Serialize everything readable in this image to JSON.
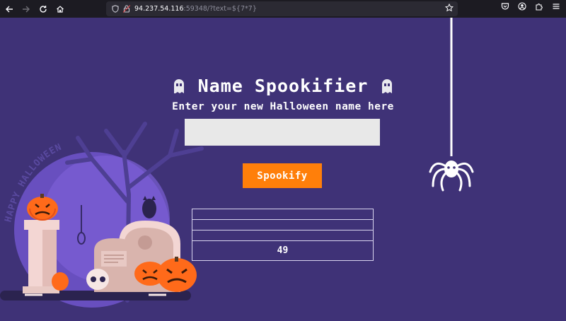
{
  "browser": {
    "url_host": "94.237.54.116",
    "url_rest": ":59348/?text=${7*7}"
  },
  "icons": {
    "back": "arrow-left-icon",
    "forward": "arrow-right-icon",
    "reload": "reload-icon",
    "home": "home-icon",
    "shield": "shield-icon",
    "lock": "insecure-lock-icon",
    "bookmark": "star-icon",
    "pocket": "pocket-icon",
    "account": "account-icon",
    "extensions": "extensions-icon",
    "menu": "hamburger-menu-icon"
  },
  "page": {
    "title": "Name Spookifier",
    "subtitle": "Enter your new Halloween name here",
    "input_value": "",
    "button_label": "Spookify",
    "results": [
      "",
      "",
      "",
      "49"
    ],
    "scene_text": "HAPPY HALLOWEEN"
  },
  "colors": {
    "background": "#3f3277",
    "button": "#ff7f0a",
    "input": "#e8e8e8",
    "text": "#ffffff"
  }
}
